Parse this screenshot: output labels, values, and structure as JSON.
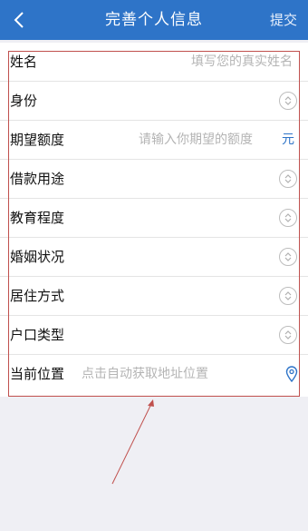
{
  "nav": {
    "title": "完善个人信息",
    "submit": "提交",
    "back_icon": "chevron-left-icon"
  },
  "form": {
    "rows": [
      {
        "label": "姓名",
        "placeholder": "填写您的真实姓名"
      },
      {
        "label": "身份",
        "icon": "select-arrows-icon"
      },
      {
        "label": "期望额度",
        "placeholder": "请输入你期望的额度",
        "unit": "元"
      },
      {
        "label": "借款用途",
        "icon": "select-arrows-icon"
      },
      {
        "label": "教育程度",
        "icon": "select-arrows-icon"
      },
      {
        "label": "婚姻状况",
        "icon": "select-arrows-icon"
      },
      {
        "label": "居住方式",
        "icon": "select-arrows-icon"
      },
      {
        "label": "户口类型",
        "icon": "select-arrows-icon"
      },
      {
        "label": "当前位置",
        "placeholder": "点击自动获取地址位置",
        "icon": "location-pin-icon"
      }
    ]
  },
  "colors": {
    "nav_bg": "#2e74c8",
    "accent": "#2e74c8",
    "annotation": "#c0504d"
  }
}
